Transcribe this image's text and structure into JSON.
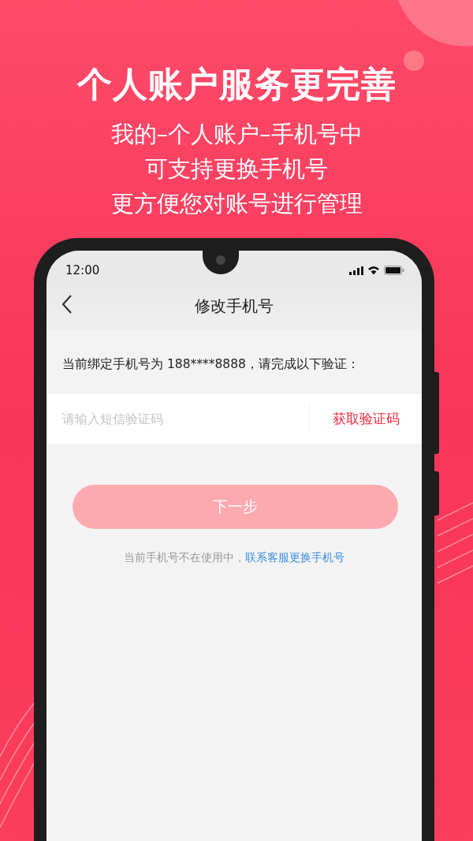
{
  "headline": "个人账户服务更完善",
  "subtitle_lines": [
    "我的–个人账户–手机号中",
    "可支持更换手机号",
    "更方便您对账号进行管理"
  ],
  "phone": {
    "status_bar": {
      "time": "12:00"
    },
    "nav": {
      "title": "修改手机号"
    },
    "info_text": "当前绑定手机号为 188****8888，请完成以下验证：",
    "code_field": {
      "placeholder": "请输入短信验证码"
    },
    "get_code_link": "获取验证码",
    "next_button": {
      "label": "下一步",
      "disabled": true
    },
    "footer": {
      "text": "当前手机号不在使用中，",
      "link": "联系客服更换手机号"
    }
  }
}
